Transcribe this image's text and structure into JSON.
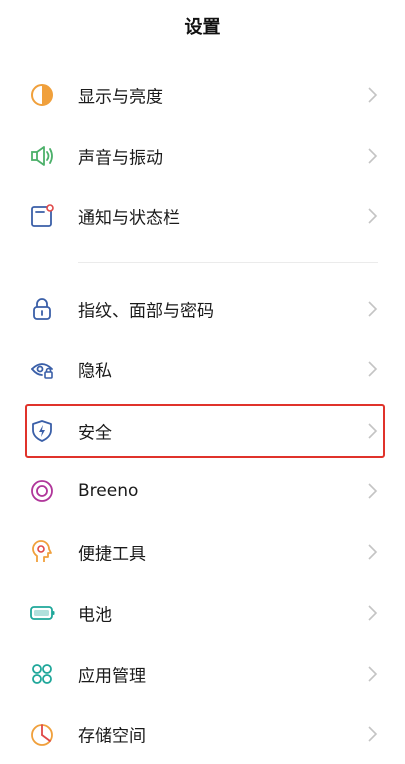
{
  "header": {
    "title": "设置"
  },
  "settings": {
    "items": [
      {
        "label": "显示与亮度",
        "icon": "display-brightness-icon"
      },
      {
        "label": "声音与振动",
        "icon": "sound-vibration-icon"
      },
      {
        "label": "通知与状态栏",
        "icon": "notification-statusbar-icon"
      },
      {
        "label": "指纹、面部与密码",
        "icon": "lock-icon"
      },
      {
        "label": "隐私",
        "icon": "privacy-eye-icon"
      },
      {
        "label": "安全",
        "icon": "security-shield-icon"
      },
      {
        "label": "Breeno",
        "icon": "breeno-icon"
      },
      {
        "label": "便捷工具",
        "icon": "convenience-tools-icon"
      },
      {
        "label": "电池",
        "icon": "battery-icon"
      },
      {
        "label": "应用管理",
        "icon": "app-management-icon"
      },
      {
        "label": "存储空间",
        "icon": "storage-icon"
      }
    ]
  },
  "colors": {
    "orange": "#F0A03C",
    "green": "#4CB06A",
    "red_accent": "#E04848",
    "blue": "#3A5FA8",
    "purple": "#B0359A",
    "teal": "#1FA79A",
    "highlight_border": "#E0332B",
    "chevron": "#C4C4C4"
  }
}
